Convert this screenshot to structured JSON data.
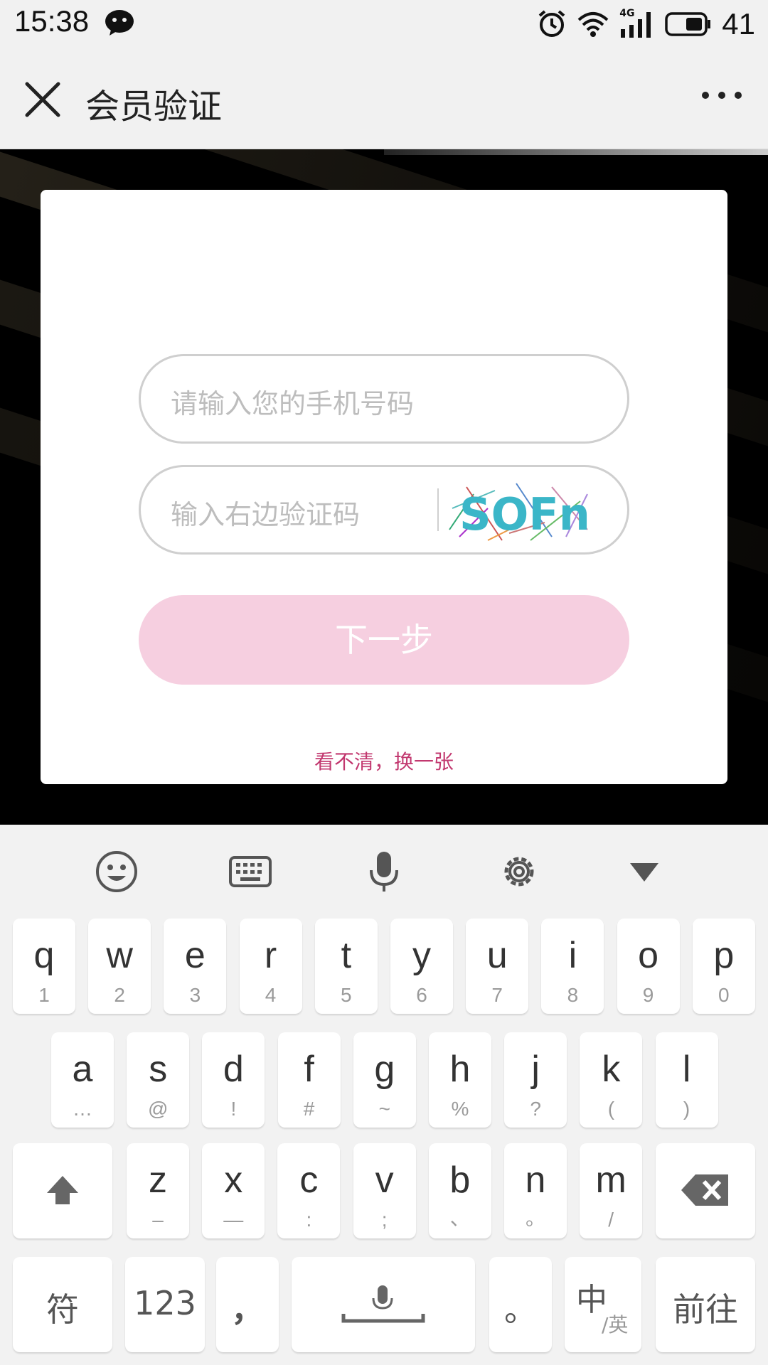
{
  "status_bar": {
    "time": "15:38",
    "network": "4G",
    "battery": "41"
  },
  "header": {
    "title": "会员验证"
  },
  "form": {
    "phone_placeholder": "请输入您的手机号码",
    "code_placeholder": "输入右边验证码",
    "captcha_text": "SOFn",
    "next_label": "下一步",
    "refresh_link": "看不清，换一张"
  },
  "keyboard": {
    "row1": [
      {
        "k": "q",
        "s": "1"
      },
      {
        "k": "w",
        "s": "2"
      },
      {
        "k": "e",
        "s": "3"
      },
      {
        "k": "r",
        "s": "4"
      },
      {
        "k": "t",
        "s": "5"
      },
      {
        "k": "y",
        "s": "6"
      },
      {
        "k": "u",
        "s": "7"
      },
      {
        "k": "i",
        "s": "8"
      },
      {
        "k": "o",
        "s": "9"
      },
      {
        "k": "p",
        "s": "0"
      }
    ],
    "row2": [
      {
        "k": "a",
        "s": "…"
      },
      {
        "k": "s",
        "s": "@"
      },
      {
        "k": "d",
        "s": "!"
      },
      {
        "k": "f",
        "s": "#"
      },
      {
        "k": "g",
        "s": "~"
      },
      {
        "k": "h",
        "s": "%"
      },
      {
        "k": "j",
        "s": "?"
      },
      {
        "k": "k",
        "s": "("
      },
      {
        "k": "l",
        "s": ")"
      }
    ],
    "row3": [
      {
        "k": "z",
        "s": "–"
      },
      {
        "k": "x",
        "s": "—"
      },
      {
        "k": "c",
        "s": ":"
      },
      {
        "k": "v",
        "s": ";"
      },
      {
        "k": "b",
        "s": "、"
      },
      {
        "k": "n",
        "s": "。"
      },
      {
        "k": "m",
        "s": "/"
      }
    ],
    "symbols_label": "符",
    "numbers_label": "123",
    "comma_label": "，",
    "period_label": "。",
    "lang_main": "中",
    "lang_sub": "/英",
    "go_label": "前往"
  }
}
